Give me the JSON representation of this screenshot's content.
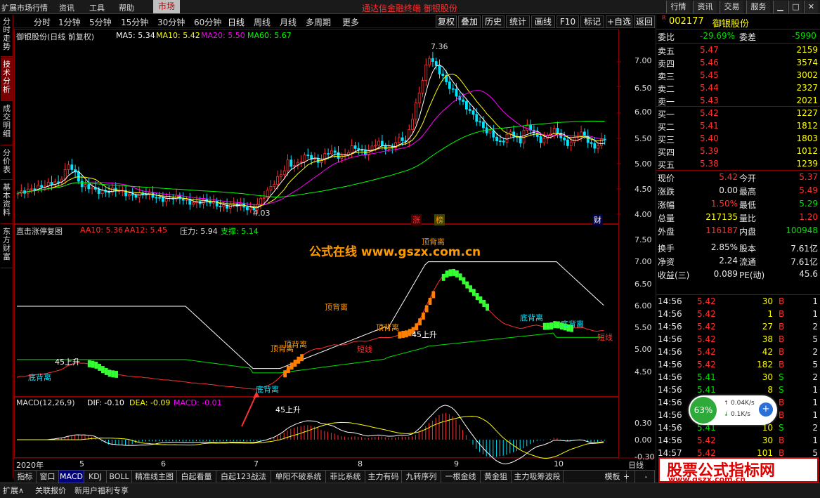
{
  "topbar": {
    "menus": [
      "扩展市场行情",
      "资讯",
      "工具",
      "帮助"
    ],
    "market_btn": "市场",
    "title": "通达信金融终端  御银股份",
    "right_buttons": [
      "行情",
      "资讯",
      "交易",
      "服务"
    ]
  },
  "vtabs": [
    "分时走势",
    "技术分析",
    "成交明细",
    "分价表",
    "基本资料",
    "东方财富"
  ],
  "periods": [
    "分时",
    "1分钟",
    "5分钟",
    "15分钟",
    "30分钟",
    "60分钟",
    "日线",
    "周线",
    "月线",
    "多周期",
    "更多"
  ],
  "active_period": "日线",
  "tools": [
    "复权",
    "叠加",
    "历史",
    "统计",
    "画线",
    "F10",
    "标记",
    "+自选",
    "返回"
  ],
  "main_chart": {
    "title": "御银股份(日线 前复权)",
    "ma5": "MA5: 5.34",
    "ma10": "MA10: 5.42",
    "ma20": "MA20: 5.50",
    "ma60": "MA60: 5.67",
    "yticks": [
      "7.00",
      "6.50",
      "6.00",
      "5.50",
      "5.00",
      "4.50",
      "4.00"
    ],
    "high_label": "7.36",
    "low_label": "4.03",
    "markers": [
      "涨",
      "榜",
      "财"
    ]
  },
  "indicator": {
    "title": "直击涨停复图",
    "aa10": "AA10: 5.36",
    "aa12": "AA12: 5.45",
    "pressure": "压力: 5.94",
    "support": "支撑: 5.14",
    "yticks": [
      "7.50",
      "7.00",
      "6.50",
      "6.00",
      "5.50",
      "5.00",
      "4.50"
    ],
    "labels": [
      "底背离",
      "45上升",
      "顶背离",
      "顶背离",
      "45上升",
      "顶背离",
      "短线",
      "顶背离",
      "45上升",
      "顶背离",
      "底背离",
      "底背离",
      "短线",
      "底背离"
    ],
    "watermark": "公式在线  www.gszx.com.cn"
  },
  "macd": {
    "title": "MACD(12,26,9)",
    "dif": "DIF: -0.10",
    "dea": "DEA: -0.09",
    "macd": "MACD: -0.01",
    "yticks": [
      "0.30",
      "0.00",
      "-0.30"
    ]
  },
  "xaxis": [
    "2020年",
    "5",
    "6",
    "7",
    "8",
    "9",
    "10"
  ],
  "xaxis_right": "日线",
  "bottom_tabs": [
    "指标",
    "窗口",
    "MACD",
    "KDJ",
    "BOLL",
    "精准线主图",
    "白起看量",
    "白起123战法",
    "单阳不破系统",
    "菲比系统",
    "主力有码",
    "九转序列",
    "一根金线",
    "黄金狙",
    "主力吸筹波段",
    "模板",
    "+",
    "-"
  ],
  "status": [
    "扩展∧",
    "关联报价",
    "新用户福利专享"
  ],
  "stock": {
    "code": "002177",
    "name": "御银股份",
    "weibi_label": "委比",
    "weibi": "-29.69%",
    "weicha_label": "委差",
    "weicha": "-5990",
    "asks": [
      {
        "l": "卖五",
        "p": "5.47",
        "v": "2159"
      },
      {
        "l": "卖四",
        "p": "5.46",
        "v": "3574"
      },
      {
        "l": "卖三",
        "p": "5.45",
        "v": "3002"
      },
      {
        "l": "卖二",
        "p": "5.44",
        "v": "2327"
      },
      {
        "l": "卖一",
        "p": "5.43",
        "v": "2021"
      }
    ],
    "bids": [
      {
        "l": "买一",
        "p": "5.42",
        "v": "1227"
      },
      {
        "l": "买二",
        "p": "5.41",
        "v": "1812"
      },
      {
        "l": "买三",
        "p": "5.40",
        "v": "1803"
      },
      {
        "l": "买四",
        "p": "5.39",
        "v": "1012"
      },
      {
        "l": "买五",
        "p": "5.38",
        "v": "1239"
      }
    ],
    "stats": [
      {
        "a": "现价",
        "b": "5.42",
        "c": "今开",
        "d": "5.37",
        "bc": "red",
        "dc": "red"
      },
      {
        "a": "涨跌",
        "b": "0.00",
        "c": "最高",
        "d": "5.49",
        "bc": "white",
        "dc": "red"
      },
      {
        "a": "涨幅",
        "b": "1.50%",
        "c": "最低",
        "d": "5.29",
        "bc": "red",
        "dc": "green"
      },
      {
        "a": "总量",
        "b": "217135",
        "c": "量比",
        "d": "1.20",
        "bc": "yellow",
        "dc": "red"
      },
      {
        "a": "外盘",
        "b": "116187",
        "c": "内盘",
        "d": "100948",
        "bc": "red",
        "dc": "green"
      },
      {
        "a": "换手",
        "b": "2.85%",
        "c": "股本",
        "d": "7.61亿",
        "bc": "white",
        "dc": "white"
      },
      {
        "a": "净资",
        "b": "2.24",
        "c": "流通",
        "d": "7.61亿",
        "bc": "white",
        "dc": "white"
      },
      {
        "a": "收益(三)",
        "b": "0.089",
        "c": "PE(动)",
        "d": "45.6",
        "bc": "white",
        "dc": "white"
      }
    ],
    "ticks": [
      {
        "t": "14:56",
        "p": "5.42",
        "v": "30",
        "s": "B",
        "n": "1"
      },
      {
        "t": "14:56",
        "p": "5.42",
        "v": "1",
        "s": "B",
        "n": "1"
      },
      {
        "t": "14:56",
        "p": "5.42",
        "v": "27",
        "s": "B",
        "n": "2"
      },
      {
        "t": "14:56",
        "p": "5.42",
        "v": "38",
        "s": "B",
        "n": "5"
      },
      {
        "t": "14:56",
        "p": "5.42",
        "v": "42",
        "s": "B",
        "n": "2"
      },
      {
        "t": "14:56",
        "p": "5.42",
        "v": "182",
        "s": "B",
        "n": "5"
      },
      {
        "t": "14:56",
        "p": "5.41",
        "v": "30",
        "s": "S",
        "n": "2"
      },
      {
        "t": "14:56",
        "p": "5.41",
        "v": "8",
        "s": "S",
        "n": "1"
      },
      {
        "t": "14:56",
        "p": "5.42",
        "v": "24",
        "s": "B",
        "n": "1"
      },
      {
        "t": "14:56",
        "p": "5.42",
        "v": "1",
        "s": "B",
        "n": "1"
      },
      {
        "t": "14:56",
        "p": "5.41",
        "v": "10",
        "s": "S",
        "n": "2"
      },
      {
        "t": "14:56",
        "p": "5.42",
        "v": "30",
        "s": "B",
        "n": "1"
      },
      {
        "t": "14:57",
        "p": "5.42",
        "v": "101",
        "s": "B",
        "n": "5"
      }
    ]
  },
  "speed": {
    "pct": "63%",
    "up": "0.04K/s",
    "down": "0.1K/s"
  },
  "ad": {
    "title": "股票公式指标网",
    "url": "www.gszx.com.cn"
  },
  "colors": {
    "up": "#ff3030",
    "down": "#00e5ff",
    "ma5": "#ffffff",
    "ma10": "#ffff00",
    "ma20": "#ff00ff",
    "ma60": "#00ff00"
  }
}
